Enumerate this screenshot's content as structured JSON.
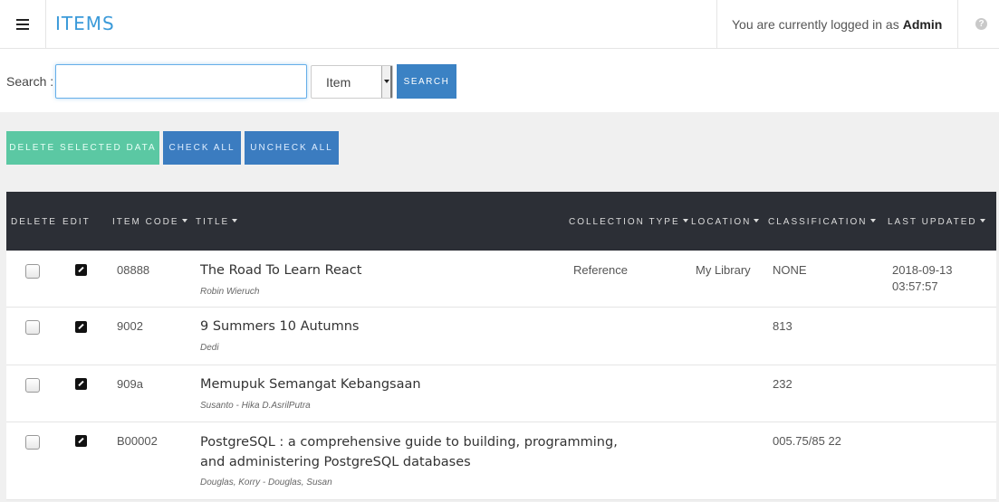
{
  "header": {
    "title": "ITEMS",
    "login_text": "You are currently logged in as",
    "user": "Admin",
    "help_glyph": "?"
  },
  "search": {
    "label": "Search :",
    "value": "",
    "placeholder": "",
    "field_selected": "Item",
    "button": "SEARCH"
  },
  "actions": {
    "delete_selected": "DELETE SELECTED DATA",
    "check_all": "CHECK ALL",
    "uncheck_all": "UNCHECK ALL"
  },
  "table": {
    "columns": {
      "delete": "DELETE",
      "edit": "EDIT",
      "item_code": "ITEM CODE",
      "title": "TITLE",
      "collection_type": "COLLECTION TYPE",
      "location": "LOCATION",
      "classification": "CLASSIFICATION",
      "last_updated": "LAST UPDATED"
    },
    "rows": [
      {
        "item_code": "08888",
        "title_line1": "The Road To Learn React",
        "title_line2": "",
        "author": "Robin Wieruch",
        "collection_type": "Reference",
        "location": "My Library",
        "classification": "NONE",
        "updated_date": "2018-09-13",
        "updated_time": "03:57:57"
      },
      {
        "item_code": "9002",
        "title_line1": "9 Summers 10 Autumns",
        "title_line2": "",
        "author": "Dedi",
        "collection_type": "",
        "location": "",
        "classification": "813",
        "updated_date": "",
        "updated_time": ""
      },
      {
        "item_code": "909a",
        "title_line1": "Memupuk Semangat Kebangsaan",
        "title_line2": "",
        "author": "Susanto - Hika D.AsrilPutra",
        "collection_type": "",
        "location": "",
        "classification": "232",
        "updated_date": "",
        "updated_time": ""
      },
      {
        "item_code": "B00002",
        "title_line1": "PostgreSQL : a comprehensive guide to building, programming,",
        "title_line2": "and administering PostgreSQL databases",
        "author": "Douglas, Korry - Douglas, Susan",
        "collection_type": "",
        "location": "",
        "classification": "005.75/85 22",
        "updated_date": "",
        "updated_time": ""
      }
    ]
  },
  "colors": {
    "accent": "#3b9ad9",
    "primary_button": "#3b7cc0",
    "danger_button": "#5bc8a3",
    "table_header": "#2c2f36"
  }
}
